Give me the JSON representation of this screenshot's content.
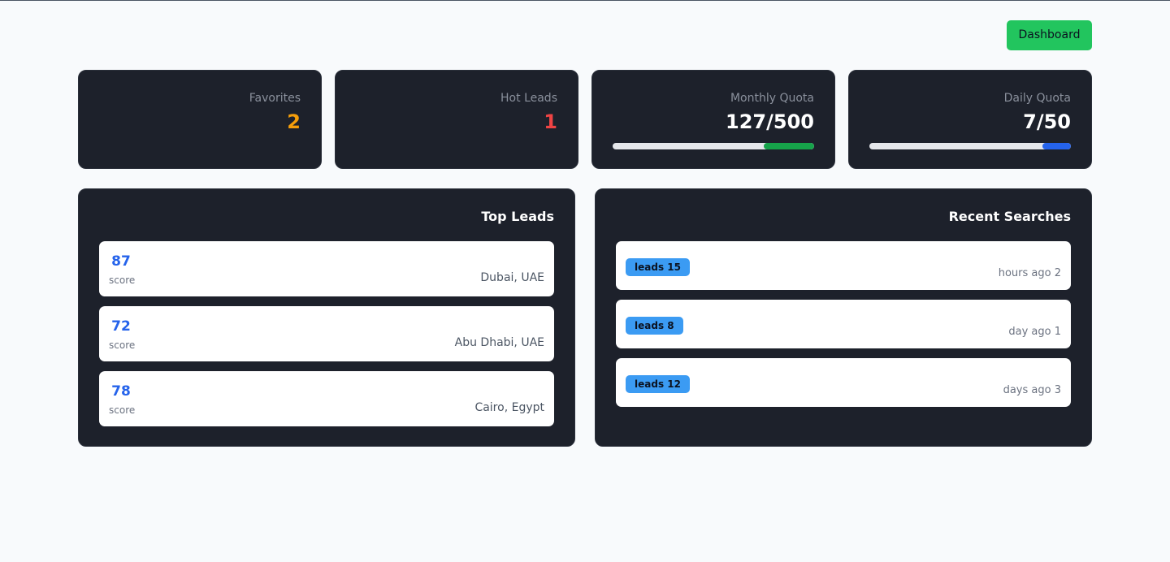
{
  "header": {
    "dashboard_label": "Dashboard"
  },
  "stats": {
    "favorites": {
      "label": "Favorites",
      "value": "2"
    },
    "hot_leads": {
      "label": "Hot Leads",
      "value": "1"
    },
    "monthly_quota": {
      "label": "Monthly Quota",
      "value": "127/500",
      "progress": 0.25,
      "color": "#16a34a"
    },
    "daily_quota": {
      "label": "Daily Quota",
      "value": "7/50",
      "progress": 0.14,
      "color": "#2563eb"
    }
  },
  "top_leads": {
    "title": "Top Leads",
    "items": [
      {
        "score": "87",
        "score_label": "score",
        "location": "Dubai, UAE"
      },
      {
        "score": "72",
        "score_label": "score",
        "location": "Abu Dhabi, UAE"
      },
      {
        "score": "78",
        "score_label": "score",
        "location": "Cairo, Egypt"
      }
    ]
  },
  "recent_searches": {
    "title": "Recent Searches",
    "items": [
      {
        "badge": "leads 15",
        "time": "hours ago 2"
      },
      {
        "badge": "leads 8",
        "time": "day ago 1"
      },
      {
        "badge": "leads 12",
        "time": "days ago 3"
      }
    ]
  }
}
